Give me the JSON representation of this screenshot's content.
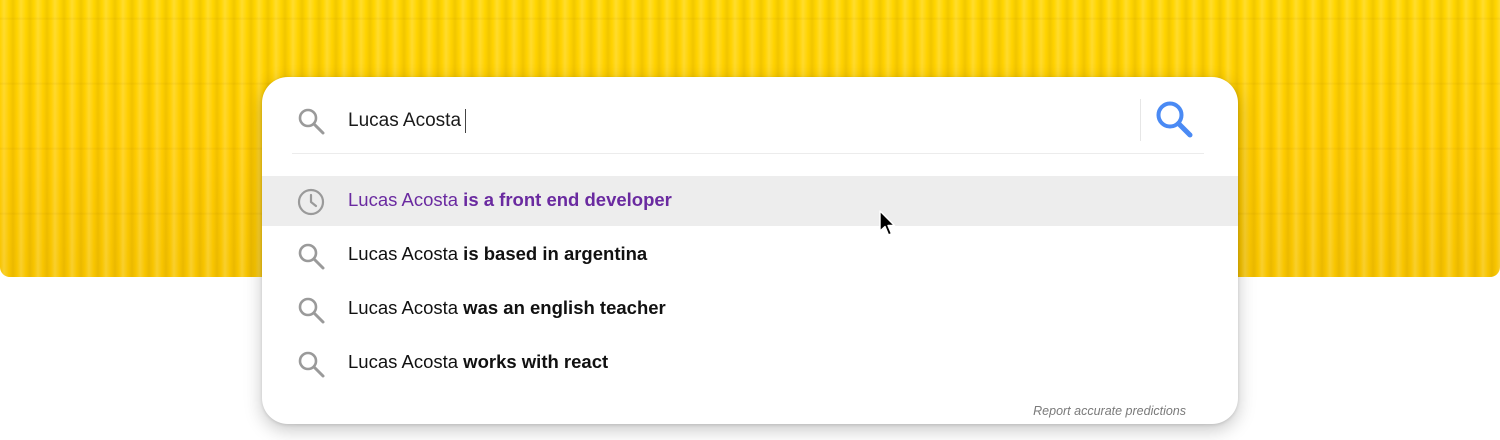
{
  "search": {
    "value": "Lucas Acosta",
    "submit_icon": "search-icon",
    "lead_icon": "search-icon"
  },
  "suggestions": [
    {
      "icon": "history-clock-icon",
      "prefix": "Lucas Acosta",
      "completion": " is a front end developer",
      "state": "highlighted",
      "visited_color": "#6a2aa0"
    },
    {
      "icon": "search-icon",
      "prefix": "Lucas Acosta",
      "completion": " is based in argentina"
    },
    {
      "icon": "search-icon",
      "prefix": "Lucas Acosta",
      "completion": " was an english teacher"
    },
    {
      "icon": "search-icon",
      "prefix": "Lucas Acosta",
      "completion": " works with react"
    }
  ],
  "footer": {
    "report_label": "Report accurate predictions"
  },
  "colors": {
    "accent_blue": "#4a8af4",
    "background_yellow": "#ffd000",
    "highlight_row": "#ededed",
    "visited_purple": "#6a2aa0"
  }
}
